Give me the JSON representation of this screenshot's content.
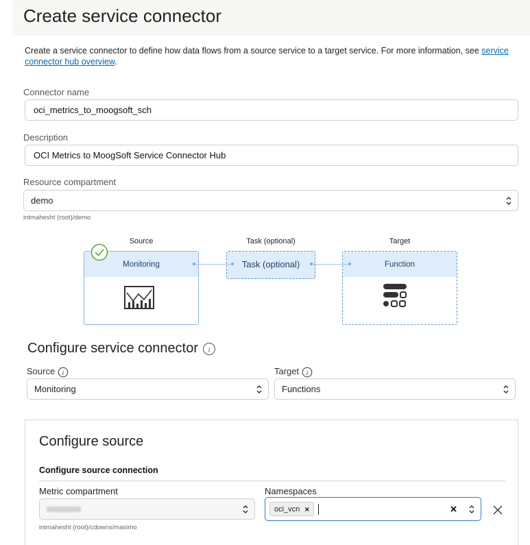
{
  "page": {
    "title": "Create service connector",
    "intro_text": "Create a service connector to define how data flows from a source service to a target service. For more information, see ",
    "intro_link": "service connector hub overview",
    "intro_end": "."
  },
  "form": {
    "connector_name": {
      "label": "Connector name",
      "value": "oci_metrics_to_moogsoft_sch"
    },
    "description": {
      "label": "Description",
      "value": "OCI Metrics to MoogSoft Service Connector Hub"
    },
    "resource_compartment": {
      "label": "Resource compartment",
      "value": "demo",
      "helper": "intmahesht (root)/demo"
    }
  },
  "diagram": {
    "source": {
      "heading": "Source",
      "name": "Monitoring"
    },
    "task": {
      "heading": "Task (optional)",
      "name": "Task (optional)"
    },
    "target": {
      "heading": "Target",
      "name": "Function"
    }
  },
  "configure": {
    "title": "Configure service connector",
    "source_label": "Source",
    "source_value": "Monitoring",
    "target_label": "Target",
    "target_value": "Functions"
  },
  "configure_source": {
    "title": "Configure source",
    "subtitle": "Configure source connection",
    "metric_compartment_label": "Metric compartment",
    "metric_compartment_helper": "intmahesht (root)/cdowns/masimo",
    "namespaces_label": "Namespaces",
    "namespace_chips": [
      "oci_vcn"
    ]
  },
  "colors": {
    "accent": "#0a66b5",
    "diagram_band": "#dfedfb",
    "diagram_border": "#5b97d4",
    "success": "#5aa832"
  }
}
